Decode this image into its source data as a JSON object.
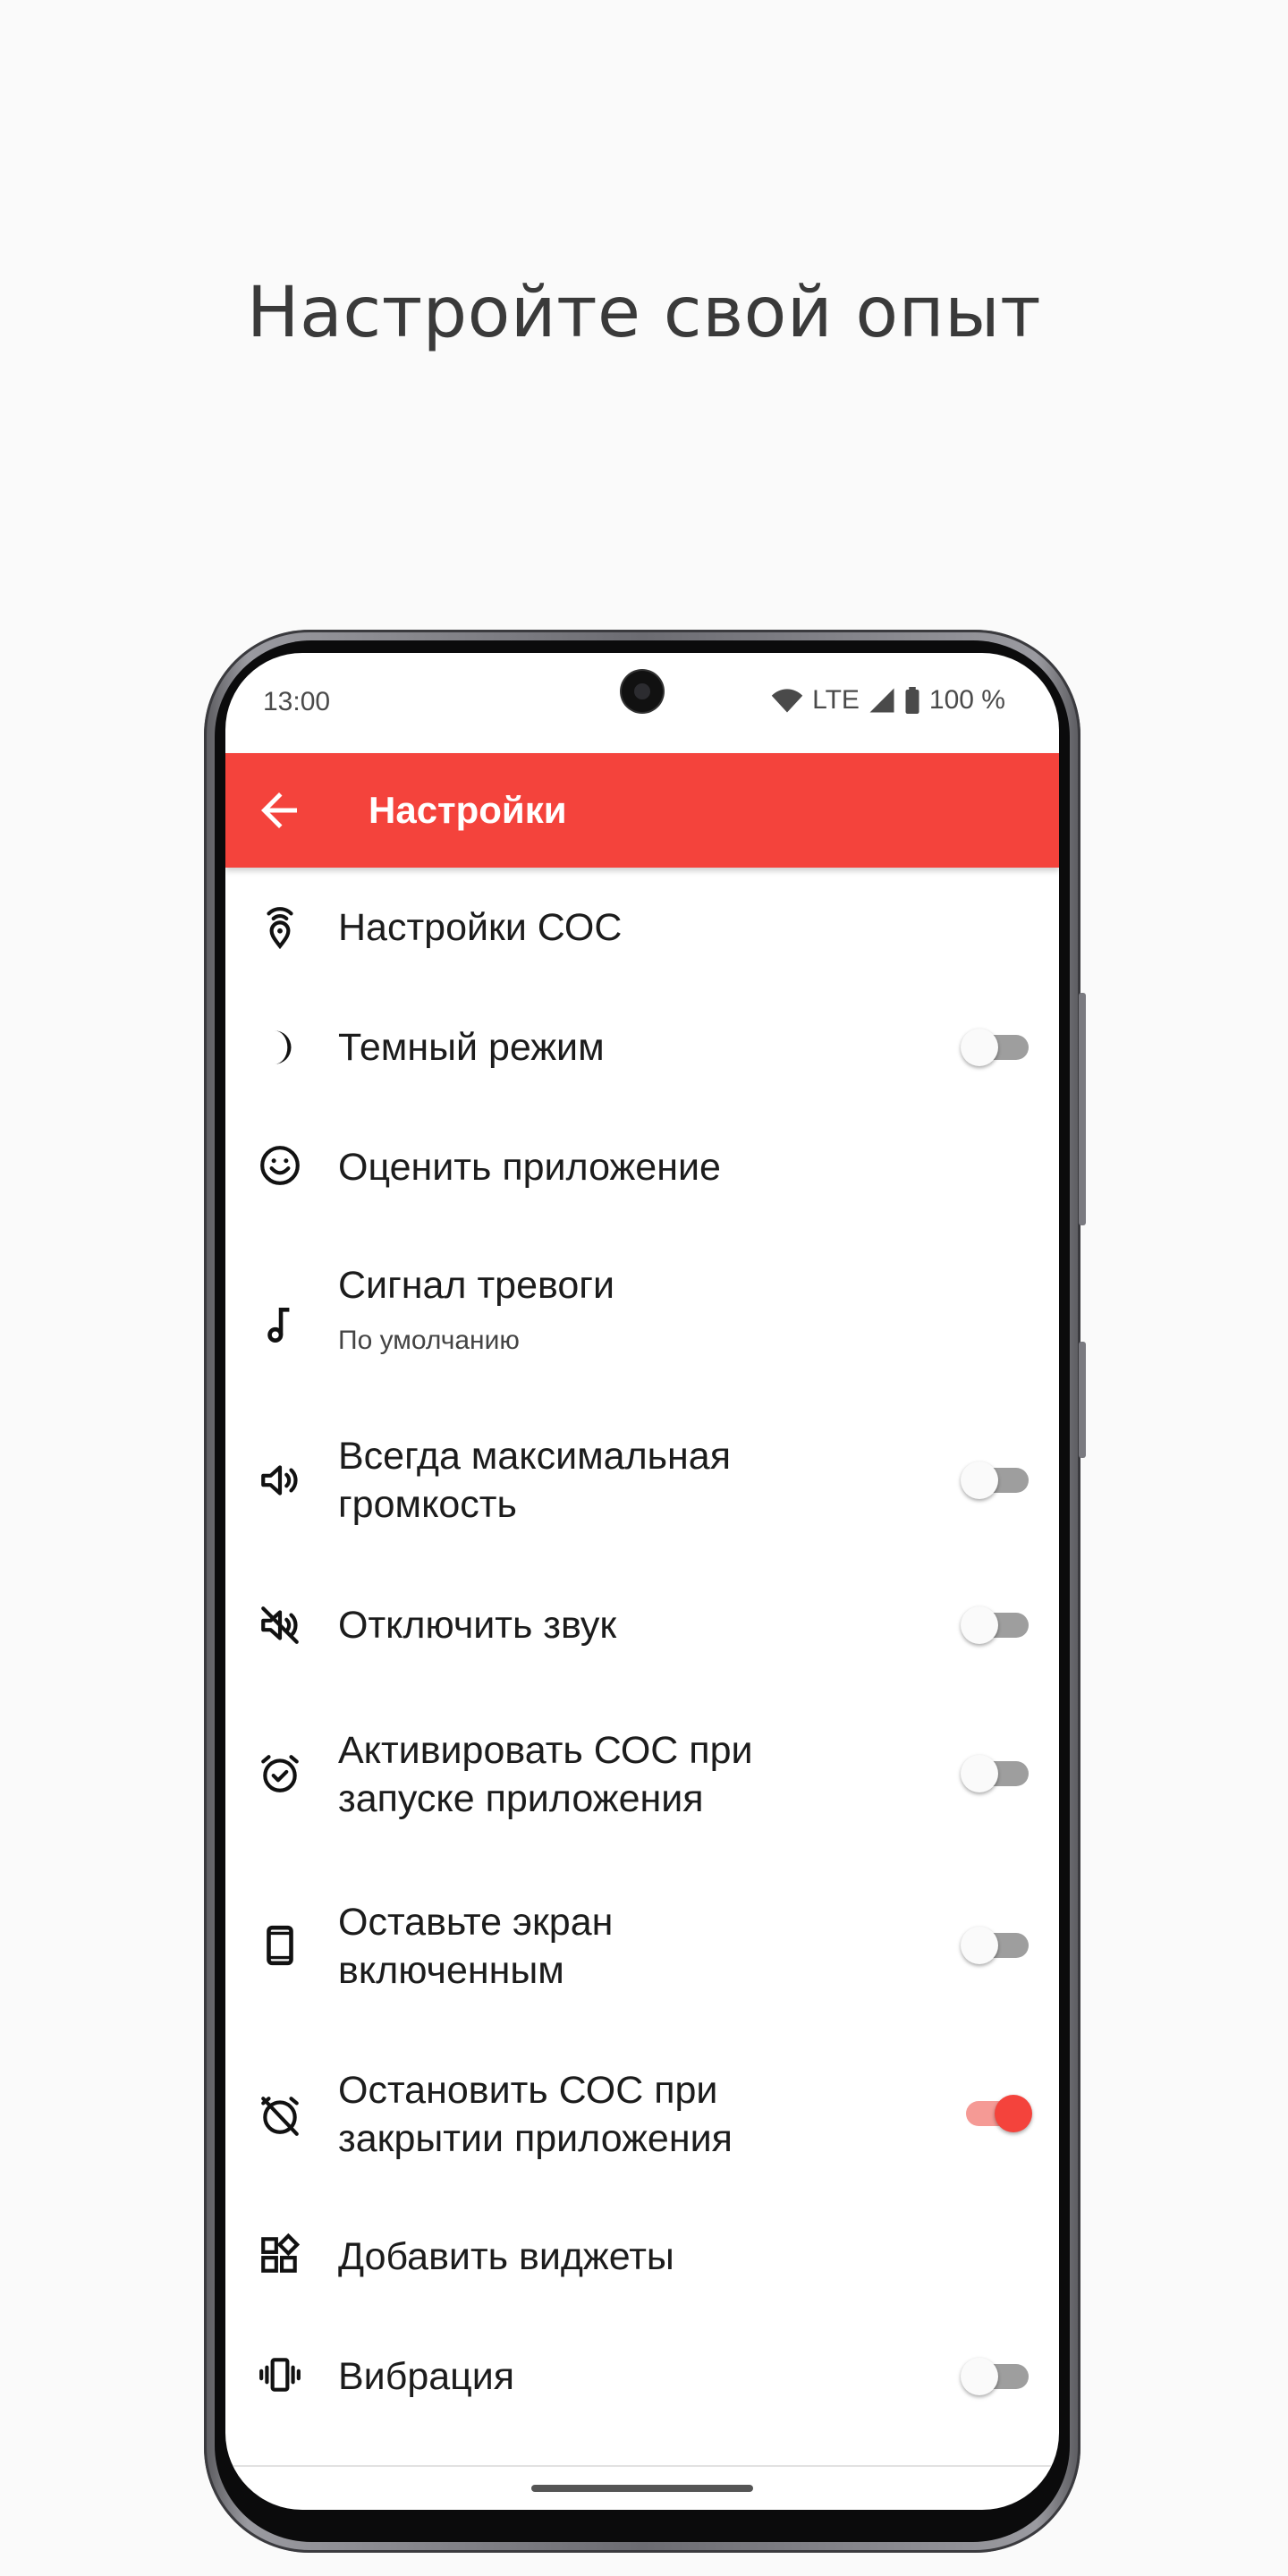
{
  "headline": "Настройте свой опыт",
  "statusbar": {
    "time": "13:00",
    "network": "LTE",
    "battery": "100 %"
  },
  "appbar": {
    "title": "Настройки",
    "back_icon": "arrow-back-icon"
  },
  "colors": {
    "accent": "#f4433c",
    "switch_on_track": "#f59a95",
    "switch_off_track": "#9e9e9e"
  },
  "settings": [
    {
      "icon": "location-broadcast-icon",
      "title": "Настройки СОС"
    },
    {
      "icon": "moon-icon",
      "title": "Темный режим",
      "toggle": false
    },
    {
      "icon": "smiley-icon",
      "title": "Оценить приложение"
    },
    {
      "icon": "music-note-icon",
      "title": "Сигнал тревоги",
      "subtitle": "По умолчанию"
    },
    {
      "icon": "volume-up-icon",
      "title": "Всегда максимальная громкость",
      "toggle": false
    },
    {
      "icon": "volume-off-icon",
      "title": "Отключить звук",
      "toggle": false
    },
    {
      "icon": "alarm-check-icon",
      "title": "Активировать СОС при запуске приложения",
      "toggle": false
    },
    {
      "icon": "phone-icon",
      "title": "Оставьте экран включенным",
      "toggle": false
    },
    {
      "icon": "alarm-off-icon",
      "title": "Остановить СОС при закрытии приложения",
      "toggle": true
    },
    {
      "icon": "widgets-icon",
      "title": "Добавить виджеты"
    },
    {
      "icon": "vibration-icon",
      "title": "Вибрация",
      "toggle": false
    }
  ]
}
